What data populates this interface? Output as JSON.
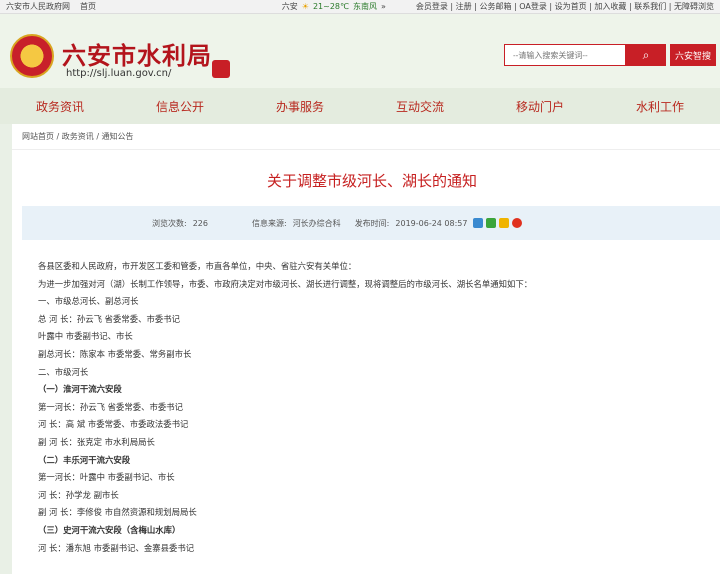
{
  "topbar": {
    "gov_link": "六安市人民政府网",
    "home": "首页",
    "city": "六安",
    "temp": "21~28℃",
    "wind": "东南风",
    "links": "会员登录 | 注册 | 公务邮箱 | OA登录 | 设为首页 | 加入收藏 | 联系我们 | 无障碍浏览"
  },
  "header": {
    "title": "六安市水利局",
    "url": "http://slj.luan.gov.cn/",
    "search_placeholder": "--请输入搜索关键词--",
    "zhjs": "六安智搜"
  },
  "nav": [
    "政务资讯",
    "信息公开",
    "办事服务",
    "互动交流",
    "移动门户",
    "水利工作"
  ],
  "breadcrumb": "网站首页 / 政务资讯 / 通知公告",
  "article": {
    "title": "关于调整市级河长、湖长的通知",
    "views_label": "浏览次数:",
    "views": "226",
    "source_label": "信息来源:",
    "source": "河长办综合科",
    "date_label": "发布时间:",
    "date": "2019-06-24 08:57"
  },
  "lines": [
    {
      "t": "各县区委和人民政府，市开发区工委和管委，市直各单位，中央、省驻六安有关单位：",
      "b": false
    },
    {
      "t": "为进一步加强对河（湖）长制工作领导，市委、市政府决定对市级河长、湖长进行调整，现将调整后的市级河长、湖长名单通知如下：",
      "b": false
    },
    {
      "t": "一、市级总河长、副总河长",
      "b": false
    },
    {
      "t": "总 河 长：孙云飞  省委常委、市委书记",
      "b": false
    },
    {
      "t": "叶露中  市委副书记、市长",
      "b": false
    },
    {
      "t": "副总河长：陈家本  市委常委、常务副市长",
      "b": false
    },
    {
      "t": "二、市级河长",
      "b": false
    },
    {
      "t": "（一）淮河干流六安段",
      "b": true
    },
    {
      "t": "第一河长：孙云飞  省委常委、市委书记",
      "b": false
    },
    {
      "t": "河    长：高  斌  市委常委、市委政法委书记",
      "b": false
    },
    {
      "t": "副 河 长：张克定  市水利局局长",
      "b": false
    },
    {
      "t": "（二）丰乐河干流六安段",
      "b": true
    },
    {
      "t": "第一河长：叶露中  市委副书记、市长",
      "b": false
    },
    {
      "t": "河    长：孙学龙  副市长",
      "b": false
    },
    {
      "t": "副 河 长：李修俊  市自然资源和规划局局长",
      "b": false
    },
    {
      "t": "（三）史河干流六安段（含梅山水库）",
      "b": true
    },
    {
      "t": "河  长：潘东旭  市委副书记、金寨县委书记",
      "b": false
    }
  ]
}
